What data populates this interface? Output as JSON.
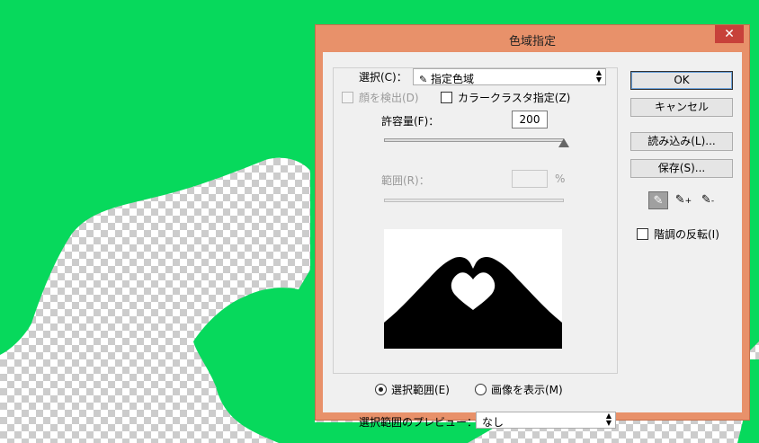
{
  "dialog": {
    "title": "色域指定",
    "close_label": "✕",
    "select": {
      "label": "選択(C)：",
      "value": "指定色域"
    },
    "face_detect": {
      "label": "顔を検出(D)",
      "checked": false,
      "enabled": false
    },
    "localized_clusters": {
      "label": "カラークラスタ指定(Z)",
      "checked": false
    },
    "fuzziness": {
      "label": "許容量(F)：",
      "value": "200",
      "fraction": 1.0
    },
    "range": {
      "label": "範囲(R)：",
      "value": "",
      "unit": "%",
      "enabled": false
    },
    "view": {
      "selection": {
        "label": "選択範囲(E)",
        "checked": true
      },
      "image": {
        "label": "画像を表示(M)",
        "checked": false
      }
    },
    "selection_preview": {
      "label": "選択範囲のプレビュー：",
      "value": "なし"
    },
    "buttons": {
      "ok": "OK",
      "cancel": "キャンセル",
      "load": "読み込み(L)...",
      "save": "保存(S)..."
    },
    "eyedroppers": [
      {
        "name": "eyedropper-icon",
        "glyph": "✎",
        "active": true
      },
      {
        "name": "eyedropper-plus-icon",
        "glyph": "✎+",
        "active": false
      },
      {
        "name": "eyedropper-minus-icon",
        "glyph": "✎-",
        "active": false
      }
    ],
    "invert": {
      "label": "階調の反転(I)",
      "checked": false
    }
  },
  "colors": {
    "canvas_green": "#07d95c",
    "titlebar": "#e8916a",
    "close": "#c7413a"
  }
}
